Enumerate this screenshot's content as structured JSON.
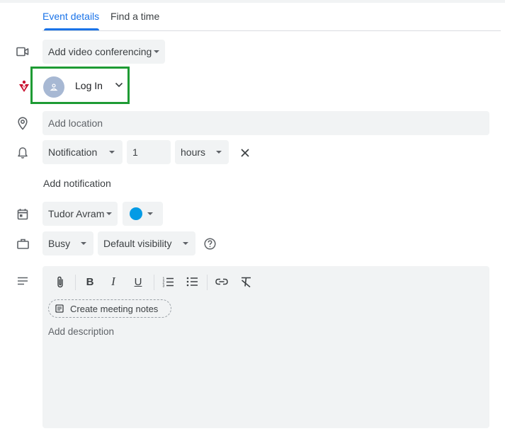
{
  "tabs": [
    {
      "label": "Event details",
      "active": true
    },
    {
      "label": "Find a time",
      "active": false
    }
  ],
  "colors": {
    "accent": "#1a73e8",
    "highlight_border": "#1e9b34",
    "calendar_color": "#039be5",
    "brand_red": "#c8102e"
  },
  "video": {
    "label": "Add video conferencing",
    "icon": "video-camera-icon"
  },
  "login": {
    "label": "Log In",
    "icon": "person-icon"
  },
  "location": {
    "placeholder": "Add location",
    "icon": "location-pin-icon"
  },
  "notification": {
    "type": "Notification",
    "amount": "1",
    "unit": "hours",
    "icon": "bell-icon"
  },
  "add_notification": {
    "label": "Add notification"
  },
  "calendar": {
    "owner": "Tudor Avram",
    "icon": "calendar-icon"
  },
  "availability": {
    "status": "Busy",
    "visibility": "Default visibility",
    "icon": "briefcase-icon"
  },
  "description": {
    "chip_label": "Create meeting notes",
    "placeholder": "Add description",
    "toolbar": {
      "bold": "B",
      "italic": "I",
      "underline": "U"
    }
  }
}
